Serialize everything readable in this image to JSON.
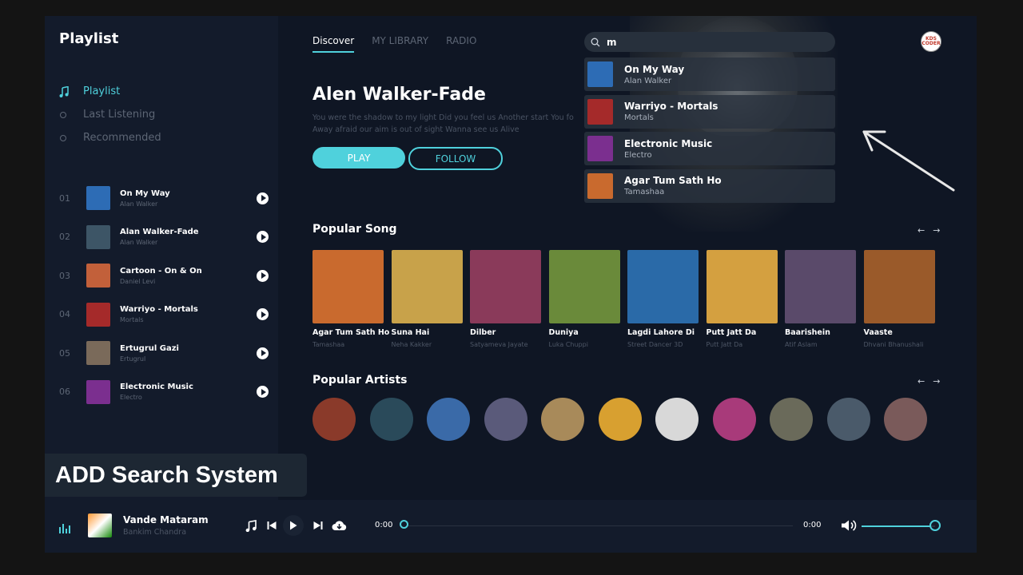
{
  "sidebar": {
    "title": "Playlist",
    "nav": [
      {
        "label": "Playlist",
        "active": true
      },
      {
        "label": "Last Listening",
        "active": false
      },
      {
        "label": "Recommended",
        "active": false
      }
    ],
    "tracks": [
      {
        "num": "01",
        "title": "On My Way",
        "artist": "Alan Walker",
        "color": "#2d6cb5"
      },
      {
        "num": "02",
        "title": "Alan Walker-Fade",
        "artist": "Alan Walker",
        "color": "#3d5566"
      },
      {
        "num": "03",
        "title": "Cartoon - On & On",
        "artist": "Daniel Levi",
        "color": "#c2603a"
      },
      {
        "num": "04",
        "title": "Warriyo - Mortals",
        "artist": "Mortals",
        "color": "#a52a2a"
      },
      {
        "num": "05",
        "title": "Ertugrul Gazi",
        "artist": "Ertugrul",
        "color": "#7a6a5a"
      },
      {
        "num": "06",
        "title": "Electronic Music",
        "artist": "Electro",
        "color": "#7b2f8f"
      }
    ]
  },
  "tabs": [
    {
      "label": "Discover",
      "active": true
    },
    {
      "label": "MY LIBRARY",
      "active": false
    },
    {
      "label": "RADIO",
      "active": false
    }
  ],
  "hero": {
    "title": "Alen Walker-Fade",
    "description": "You were the shadow to my light Did you feel us Another start You fo Away afraid our aim is out of sight Wanna see us Alive",
    "play_label": "PLAY",
    "follow_label": "FOLLOW"
  },
  "search": {
    "value": "m",
    "results": [
      {
        "title": "On My Way",
        "artist": "Alan Walker",
        "color": "#2d6cb5"
      },
      {
        "title": "Warriyo - Mortals",
        "artist": "Mortals",
        "color": "#a52a2a"
      },
      {
        "title": "Electronic Music",
        "artist": "Electro",
        "color": "#7b2f8f"
      },
      {
        "title": "Agar Tum Sath Ho",
        "artist": "Tamashaa",
        "color": "#c96a2e"
      }
    ]
  },
  "avatar": {
    "line1": "KDS",
    "line2": "CODER"
  },
  "popular_songs": {
    "title": "Popular Song",
    "items": [
      {
        "title": "Agar Tum Sath Ho",
        "artist": "Tamashaa",
        "color": "#c96a2e"
      },
      {
        "title": "Suna Hai",
        "artist": "Neha Kakker",
        "color": "#c8a24a"
      },
      {
        "title": "Dilber",
        "artist": "Satyameva Jayate",
        "color": "#8a3a5a"
      },
      {
        "title": "Duniya",
        "artist": "Luka Chuppi",
        "color": "#6a8a3a"
      },
      {
        "title": "Lagdi Lahore Di",
        "artist": "Street Dancer 3D",
        "color": "#2a6aa8"
      },
      {
        "title": "Putt Jatt Da",
        "artist": "Putt Jatt Da",
        "color": "#d4a040"
      },
      {
        "title": "Baarishein",
        "artist": "Atif Aslam",
        "color": "#5a4a6a"
      },
      {
        "title": "Vaaste",
        "artist": "Dhvani Bhanushali",
        "color": "#9a5a2a"
      }
    ]
  },
  "popular_artists": {
    "title": "Popular Artists",
    "colors": [
      "#8a3a2a",
      "#2a4a5a",
      "#3a6aa8",
      "#5a5a7a",
      "#a88a5a",
      "#d8a030",
      "#d8d8d8",
      "#a83a7a",
      "#6a6a5a",
      "#4a5a6a",
      "#7a5a5a"
    ]
  },
  "overlay": {
    "caption": "ADD Search System"
  },
  "player": {
    "title": "Vande Mataram",
    "artist": "Bankim Chandra",
    "current_time": "0:00",
    "duration": "0:00",
    "volume": 0.95,
    "progress": 0
  }
}
